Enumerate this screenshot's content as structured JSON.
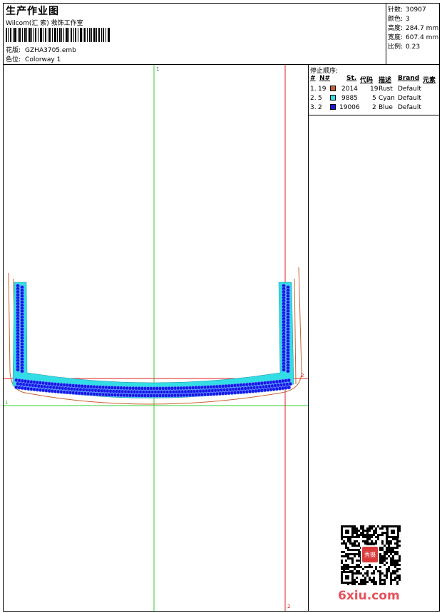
{
  "header": {
    "title": "生产作业图",
    "studio": "Wilcom(汇 索) 救饰工作室",
    "design_label": "花版:",
    "design_value": "GZHA3705.emb",
    "colorway_label": "色位:",
    "colorway_value": "Colorway 1"
  },
  "stats": [
    {
      "label": "针数:",
      "value": "30907"
    },
    {
      "label": "颜色:",
      "value": "3"
    },
    {
      "label": "高度:",
      "value": "284.7 mm"
    },
    {
      "label": "宽度:",
      "value": "607.4 mm"
    },
    {
      "label": "比例:",
      "value": "0.23"
    }
  ],
  "stop_sequence": {
    "title": "停止顺序:",
    "columns": [
      "#",
      "N#",
      "St.",
      "代码",
      "描述",
      "Brand",
      "元素"
    ],
    "rows": [
      {
        "index": "1.",
        "needle": "19",
        "color": "#c8612e",
        "stitches": "2014",
        "code": "19",
        "desc": "Rust",
        "brand": "Default"
      },
      {
        "index": "2.",
        "needle": "5",
        "color": "#33dde6",
        "stitches": "9885",
        "code": "5",
        "desc": "Cyan",
        "brand": "Default"
      },
      {
        "index": "3.",
        "needle": "2",
        "color": "#1616e8",
        "stitches": "19006",
        "code": "2",
        "desc": "Blue",
        "brand": "Default"
      }
    ]
  },
  "canvas": {
    "marker_top": "1",
    "marker_left": "1",
    "marker_right": "2",
    "marker_bottom": "2"
  },
  "watermark": "6xiu.com",
  "qr_seal": "秀摄"
}
